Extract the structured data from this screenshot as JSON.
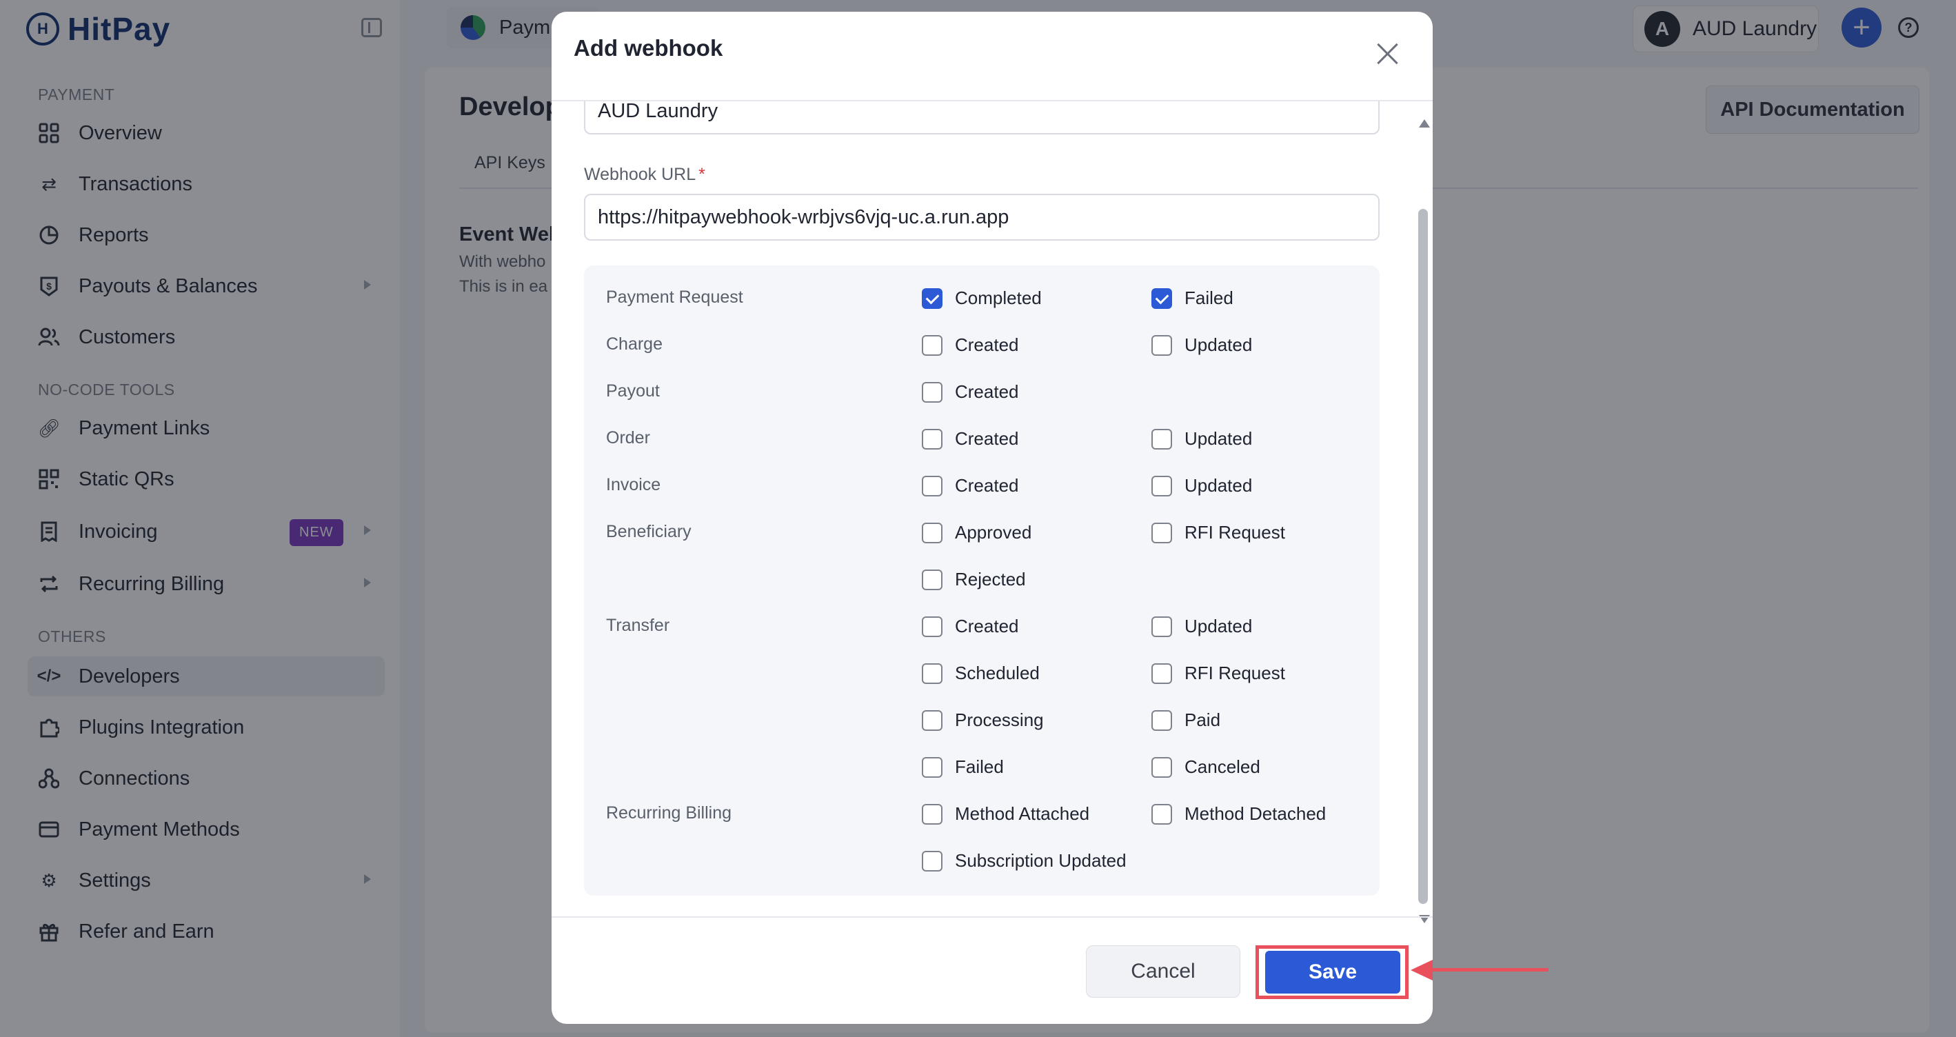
{
  "app": {
    "logo_text": "HitPay"
  },
  "sidebar": {
    "sections": {
      "payment": "PAYMENT",
      "nocode": "NO-CODE TOOLS",
      "others": "OTHERS"
    },
    "items": [
      {
        "label": "Overview",
        "icon": "grid-icon"
      },
      {
        "label": "Transactions",
        "icon": "swap-arrows-icon"
      },
      {
        "label": "Reports",
        "icon": "pie-chart-icon"
      },
      {
        "label": "Payouts & Balances",
        "icon": "dollar-shield-icon"
      },
      {
        "label": "Customers",
        "icon": "users-icon"
      },
      {
        "label": "Payment Links",
        "icon": "link-icon"
      },
      {
        "label": "Static QRs",
        "icon": "qr-code-icon"
      },
      {
        "label": "Invoicing",
        "icon": "invoice-icon",
        "badge": "NEW"
      },
      {
        "label": "Recurring Billing",
        "icon": "repeat-icon"
      },
      {
        "label": "Developers",
        "icon": "code-icon"
      },
      {
        "label": "Plugins Integration",
        "icon": "puzzle-icon"
      },
      {
        "label": "Connections",
        "icon": "network-icon"
      },
      {
        "label": "Payment Methods",
        "icon": "card-icon"
      },
      {
        "label": "Settings",
        "icon": "gear-icon"
      },
      {
        "label": "Refer and Earn",
        "icon": "gift-icon"
      }
    ]
  },
  "header": {
    "business_switch": "Paym",
    "account_initial": "A",
    "account_name": "AUD Laundry",
    "plus": "+",
    "help": "?"
  },
  "page": {
    "title": "Develop",
    "api_doc_button": "API Documentation",
    "tab_api_keys": "API Keys",
    "section_title": "Event Web",
    "section_desc_1": "With webho",
    "section_desc_2": "This is in ea"
  },
  "modal": {
    "title": "Add webhook",
    "name_value": "AUD Laundry",
    "url_label": "Webhook URL",
    "url_required": "*",
    "url_value": "https://hitpaywebhook-wrbjvs6vjq-uc.a.run.app",
    "events": {
      "payment_request": {
        "label": "Payment Request",
        "completed": "Completed",
        "failed": "Failed"
      },
      "charge": {
        "label": "Charge",
        "created": "Created",
        "updated": "Updated"
      },
      "payout": {
        "label": "Payout",
        "created": "Created"
      },
      "order": {
        "label": "Order",
        "created": "Created",
        "updated": "Updated"
      },
      "invoice": {
        "label": "Invoice",
        "created": "Created",
        "updated": "Updated"
      },
      "beneficiary": {
        "label": "Beneficiary",
        "approved": "Approved",
        "rfi_request": "RFI Request",
        "rejected": "Rejected"
      },
      "transfer": {
        "label": "Transfer",
        "created": "Created",
        "updated": "Updated",
        "scheduled": "Scheduled",
        "rfi_request": "RFI Request",
        "processing": "Processing",
        "paid": "Paid",
        "failed": "Failed",
        "canceled": "Canceled"
      },
      "recurring_billing": {
        "label": "Recurring Billing",
        "method_attached": "Method Attached",
        "method_detached": "Method Detached",
        "subscription_updated": "Subscription Updated"
      }
    },
    "cancel_button": "Cancel",
    "save_button": "Save"
  },
  "colors": {
    "accent": "#2c5ad6",
    "highlight": "#e8505b",
    "badge": "#7a36c2"
  }
}
